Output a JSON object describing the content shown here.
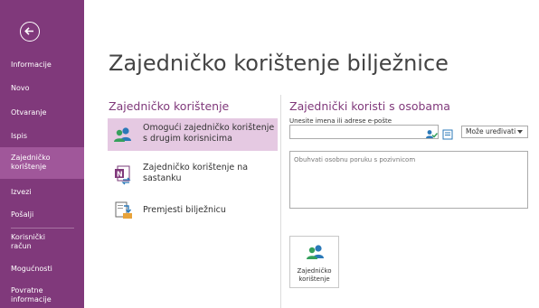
{
  "sidebar": {
    "items": [
      {
        "label": "Informacije"
      },
      {
        "label": "Novo"
      },
      {
        "label": "Otvaranje"
      },
      {
        "label": "Ispis"
      },
      {
        "label": "Zajedničko korištenje"
      },
      {
        "label": "Izvezi"
      },
      {
        "label": "Pošalji"
      },
      {
        "label": "Korisnički račun"
      },
      {
        "label": "Mogućnosti"
      },
      {
        "label": "Povratne informacije"
      }
    ],
    "active_index": 4
  },
  "page": {
    "title": "Zajedničko korištenje bilježnice"
  },
  "share_section": {
    "title": "Zajedničko korištenje",
    "options": [
      {
        "label": "Omogući zajedničko korištenje s drugim korisnicima",
        "icon": "people-icon",
        "selected": true
      },
      {
        "label": "Zajedničko korištenje na sastanku",
        "icon": "onenote-meeting-icon",
        "selected": false
      },
      {
        "label": "Premjesti bilježnicu",
        "icon": "move-notebook-icon",
        "selected": false
      }
    ]
  },
  "people_section": {
    "title": "Zajednički koristi s osobama",
    "email_label": "Unesite imena ili adrese e-pošte",
    "email_value": "",
    "permission_value": "Može uređivati",
    "message_placeholder": "Obuhvati osobnu poruku s pozivnicom",
    "share_button_label": "Zajedničko korištenje"
  },
  "colors": {
    "sidebar": "#80397b",
    "sidebar_active": "#a0579a",
    "selected_option": "#e5c9e2",
    "accent": "#80397b"
  }
}
